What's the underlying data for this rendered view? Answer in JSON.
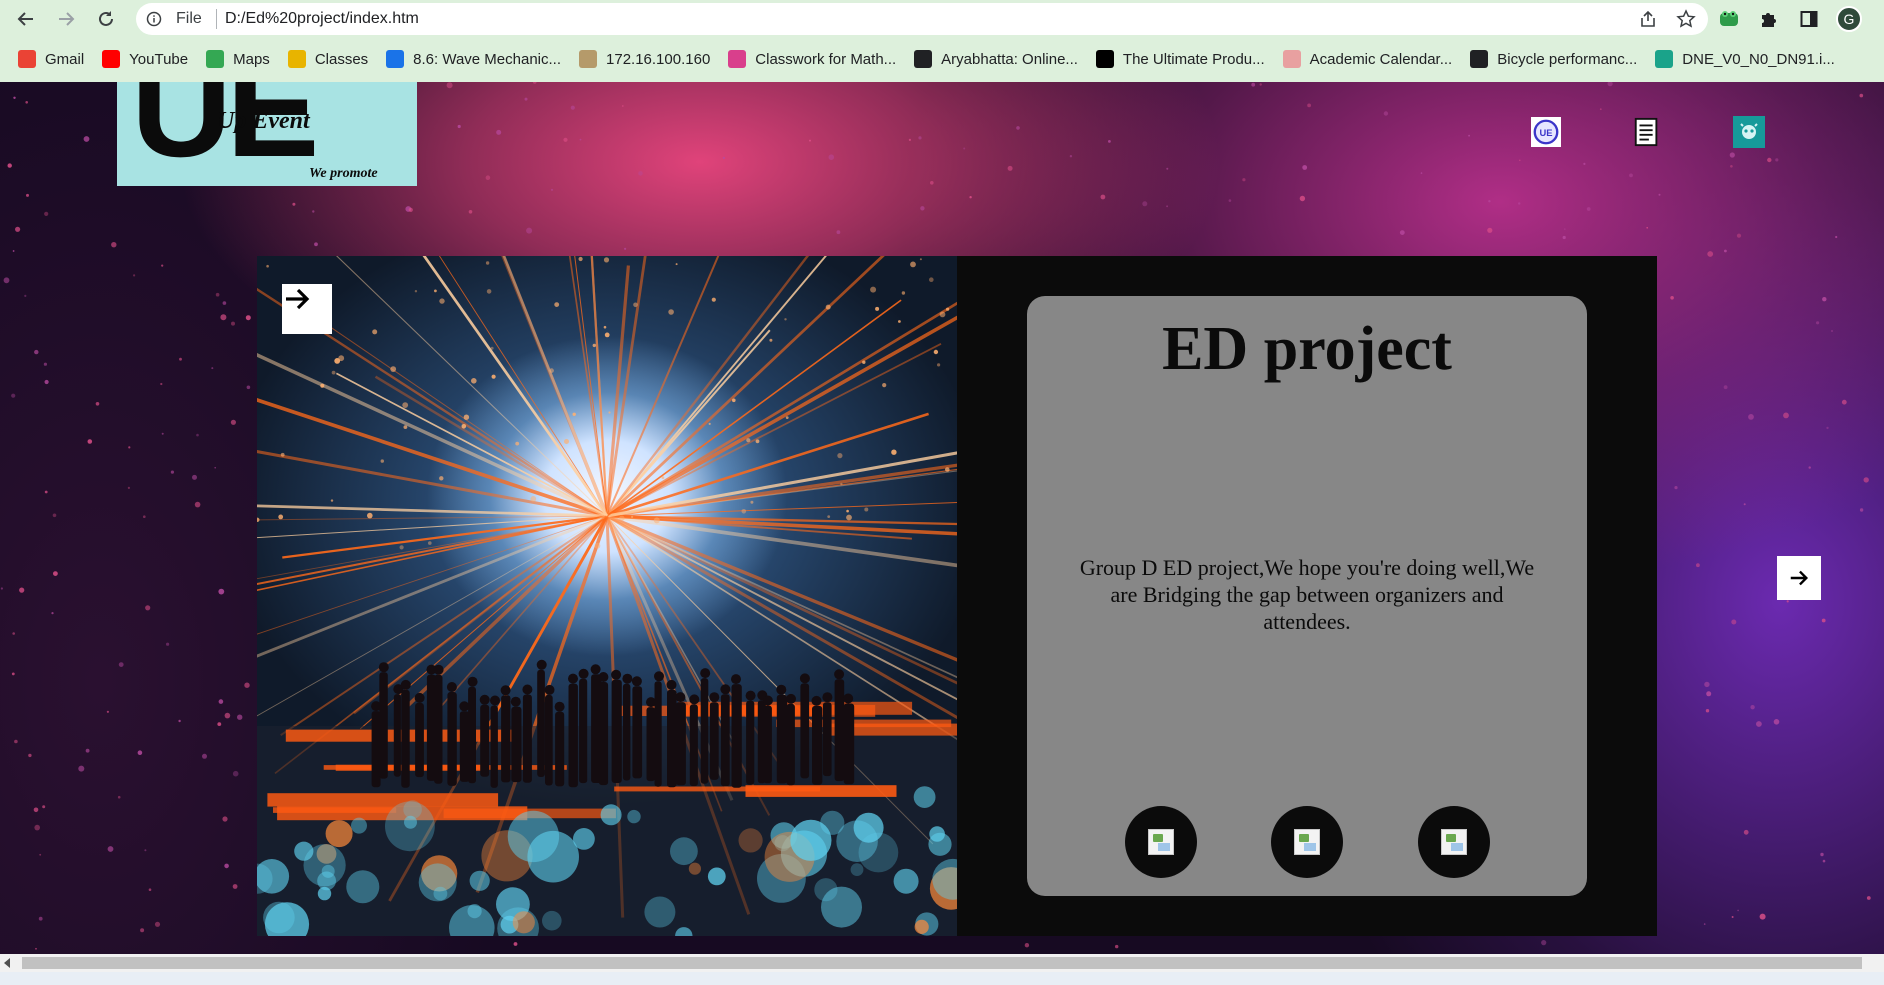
{
  "browser": {
    "file_label": "File",
    "url": "D:/Ed%20project/index.htm",
    "profile_initial": "G",
    "bookmarks": [
      {
        "label": "Gmail",
        "icon": "gmail-icon",
        "color": "#ea4335"
      },
      {
        "label": "YouTube",
        "icon": "youtube-icon",
        "color": "#ff0000"
      },
      {
        "label": "Maps",
        "icon": "maps-icon",
        "color": "#34a853"
      },
      {
        "label": "Classes",
        "icon": "classes-icon",
        "color": "#e8b400"
      },
      {
        "label": "8.6: Wave Mechanic...",
        "icon": "flask-icon",
        "color": "#1a73e8"
      },
      {
        "label": "172.16.100.160",
        "icon": "globe-icon",
        "color": "#b59a6a"
      },
      {
        "label": "Classwork for Math...",
        "icon": "classwork-icon",
        "color": "#d93f8c"
      },
      {
        "label": "Aryabhatta: Online...",
        "icon": "aryabhatta-icon",
        "color": "#202124"
      },
      {
        "label": "The Ultimate Produ...",
        "icon": "jc-icon",
        "color": "#000000"
      },
      {
        "label": "Academic Calendar...",
        "icon": "calendar-icon",
        "color": "#e8a0a0"
      },
      {
        "label": "Bicycle performanc...",
        "icon": "wikipedia-icon",
        "color": "#202124"
      },
      {
        "label": "DNE_V0_N0_DN91.i...",
        "icon": "dne-icon",
        "color": "#1aa38a"
      }
    ]
  },
  "page": {
    "logo": {
      "letters": "UE",
      "name": "Up Event",
      "tagline": "We promote",
      "bg": "#a8e3e3"
    },
    "top_icons": [
      "ue-logo-icon",
      "document-icon",
      "robot-icon"
    ],
    "hero": {
      "title": "ED project",
      "description": "Group D ED project,We hope you're doing well,We are Bridging the gap between organizers and attendees."
    },
    "social_buttons": [
      "social-image-1",
      "social-image-2",
      "social-image-3"
    ],
    "colors": {
      "panel": "#878787",
      "card": "#0b0b0b"
    }
  }
}
